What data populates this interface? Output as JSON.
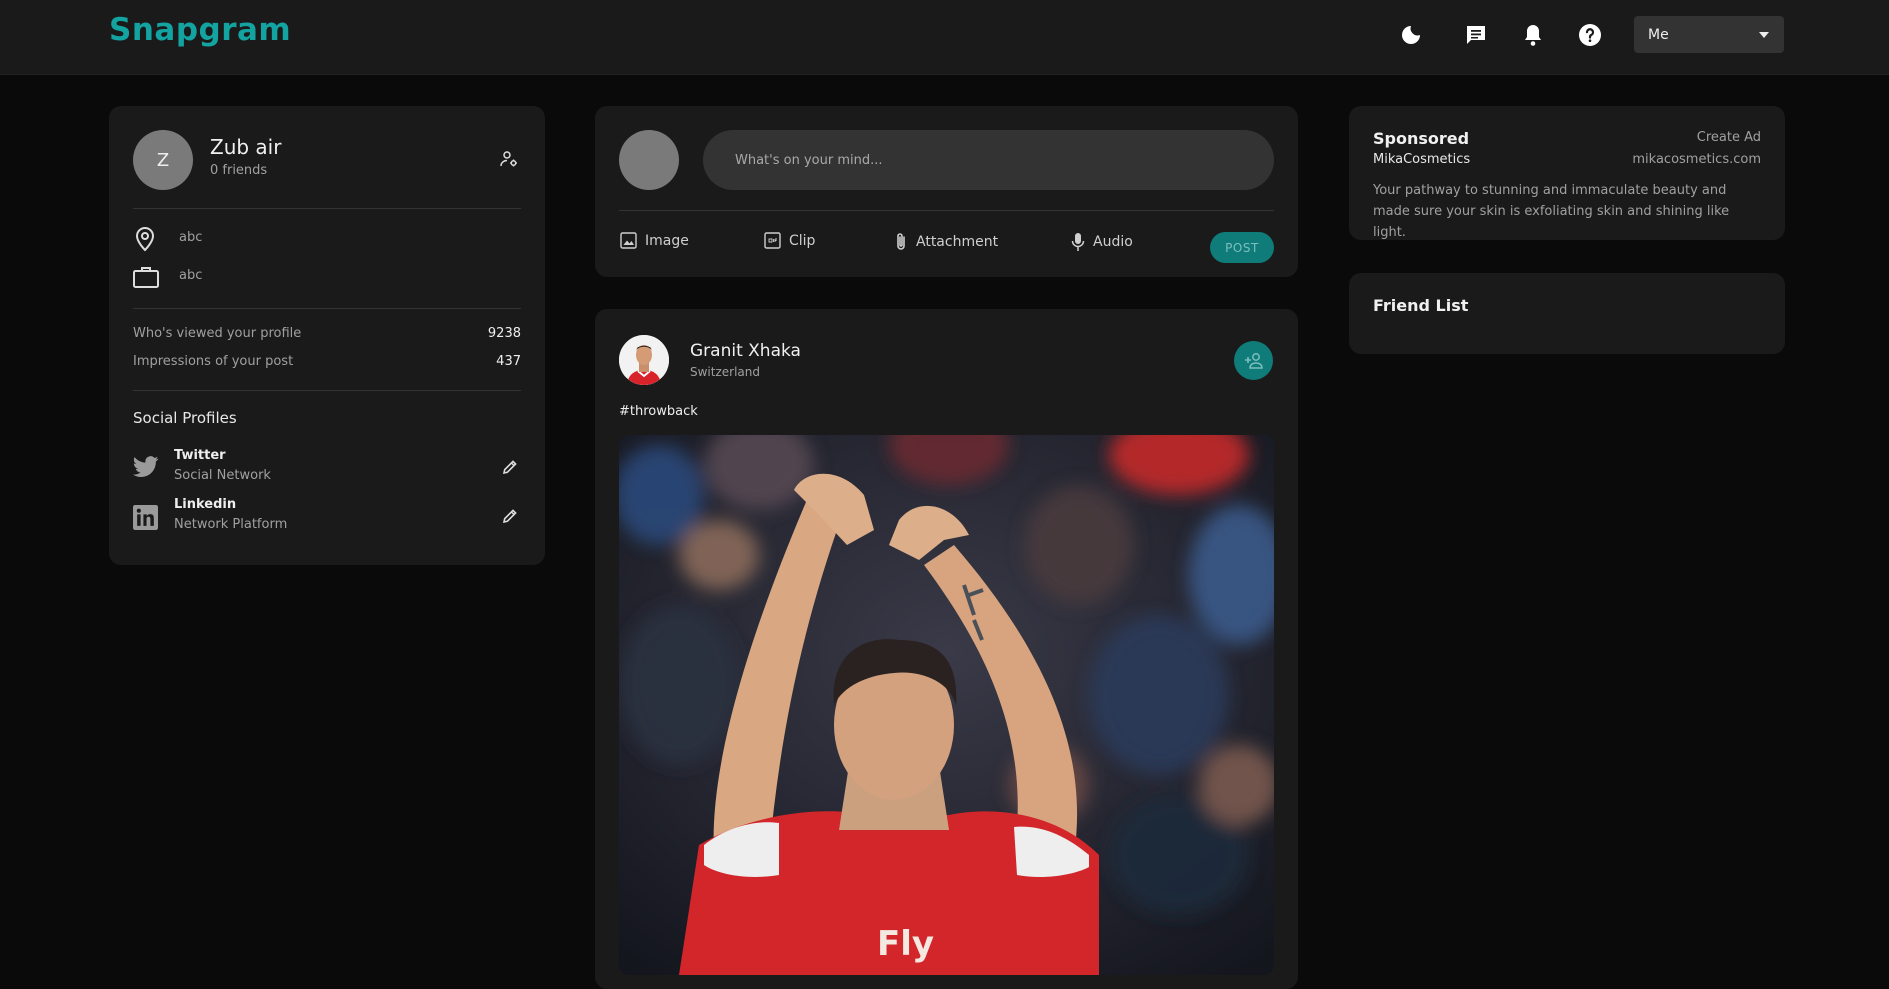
{
  "app": {
    "name": "Snapgram"
  },
  "navbar": {
    "me_label": "Me"
  },
  "profile": {
    "initial": "Z",
    "name": "Zub air",
    "friends": "0 friends",
    "location": "abc",
    "occupation": "abc",
    "stats": [
      {
        "label": "Who's viewed your profile",
        "value": "9238"
      },
      {
        "label": "Impressions of your post",
        "value": "437"
      }
    ],
    "social_title": "Social Profiles",
    "socials": [
      {
        "name": "Twitter",
        "type": "Social Network"
      },
      {
        "name": "Linkedin",
        "type": "Network Platform"
      }
    ]
  },
  "composer": {
    "placeholder": "What's on your mind...",
    "actions": {
      "image": "Image",
      "clip": "Clip",
      "attachment": "Attachment",
      "audio": "Audio"
    },
    "post_label": "POST"
  },
  "post": {
    "author": "Granit Xhaka",
    "location": "Switzerland",
    "caption": "#throwback",
    "jersey_text": "Fly"
  },
  "sponsored": {
    "title": "Sponsored",
    "create_ad": "Create Ad",
    "brand": "MikaCosmetics",
    "site": "mikacosmetics.com",
    "text": "Your pathway to stunning and immaculate beauty and made sure your skin is exfoliating skin and shining like light."
  },
  "friend_list": {
    "title": "Friend List"
  },
  "colors": {
    "accent": "#13a3a0",
    "background": "#0a0a0a",
    "card": "#1a1a1a",
    "navbar": "#1a1a1a"
  }
}
